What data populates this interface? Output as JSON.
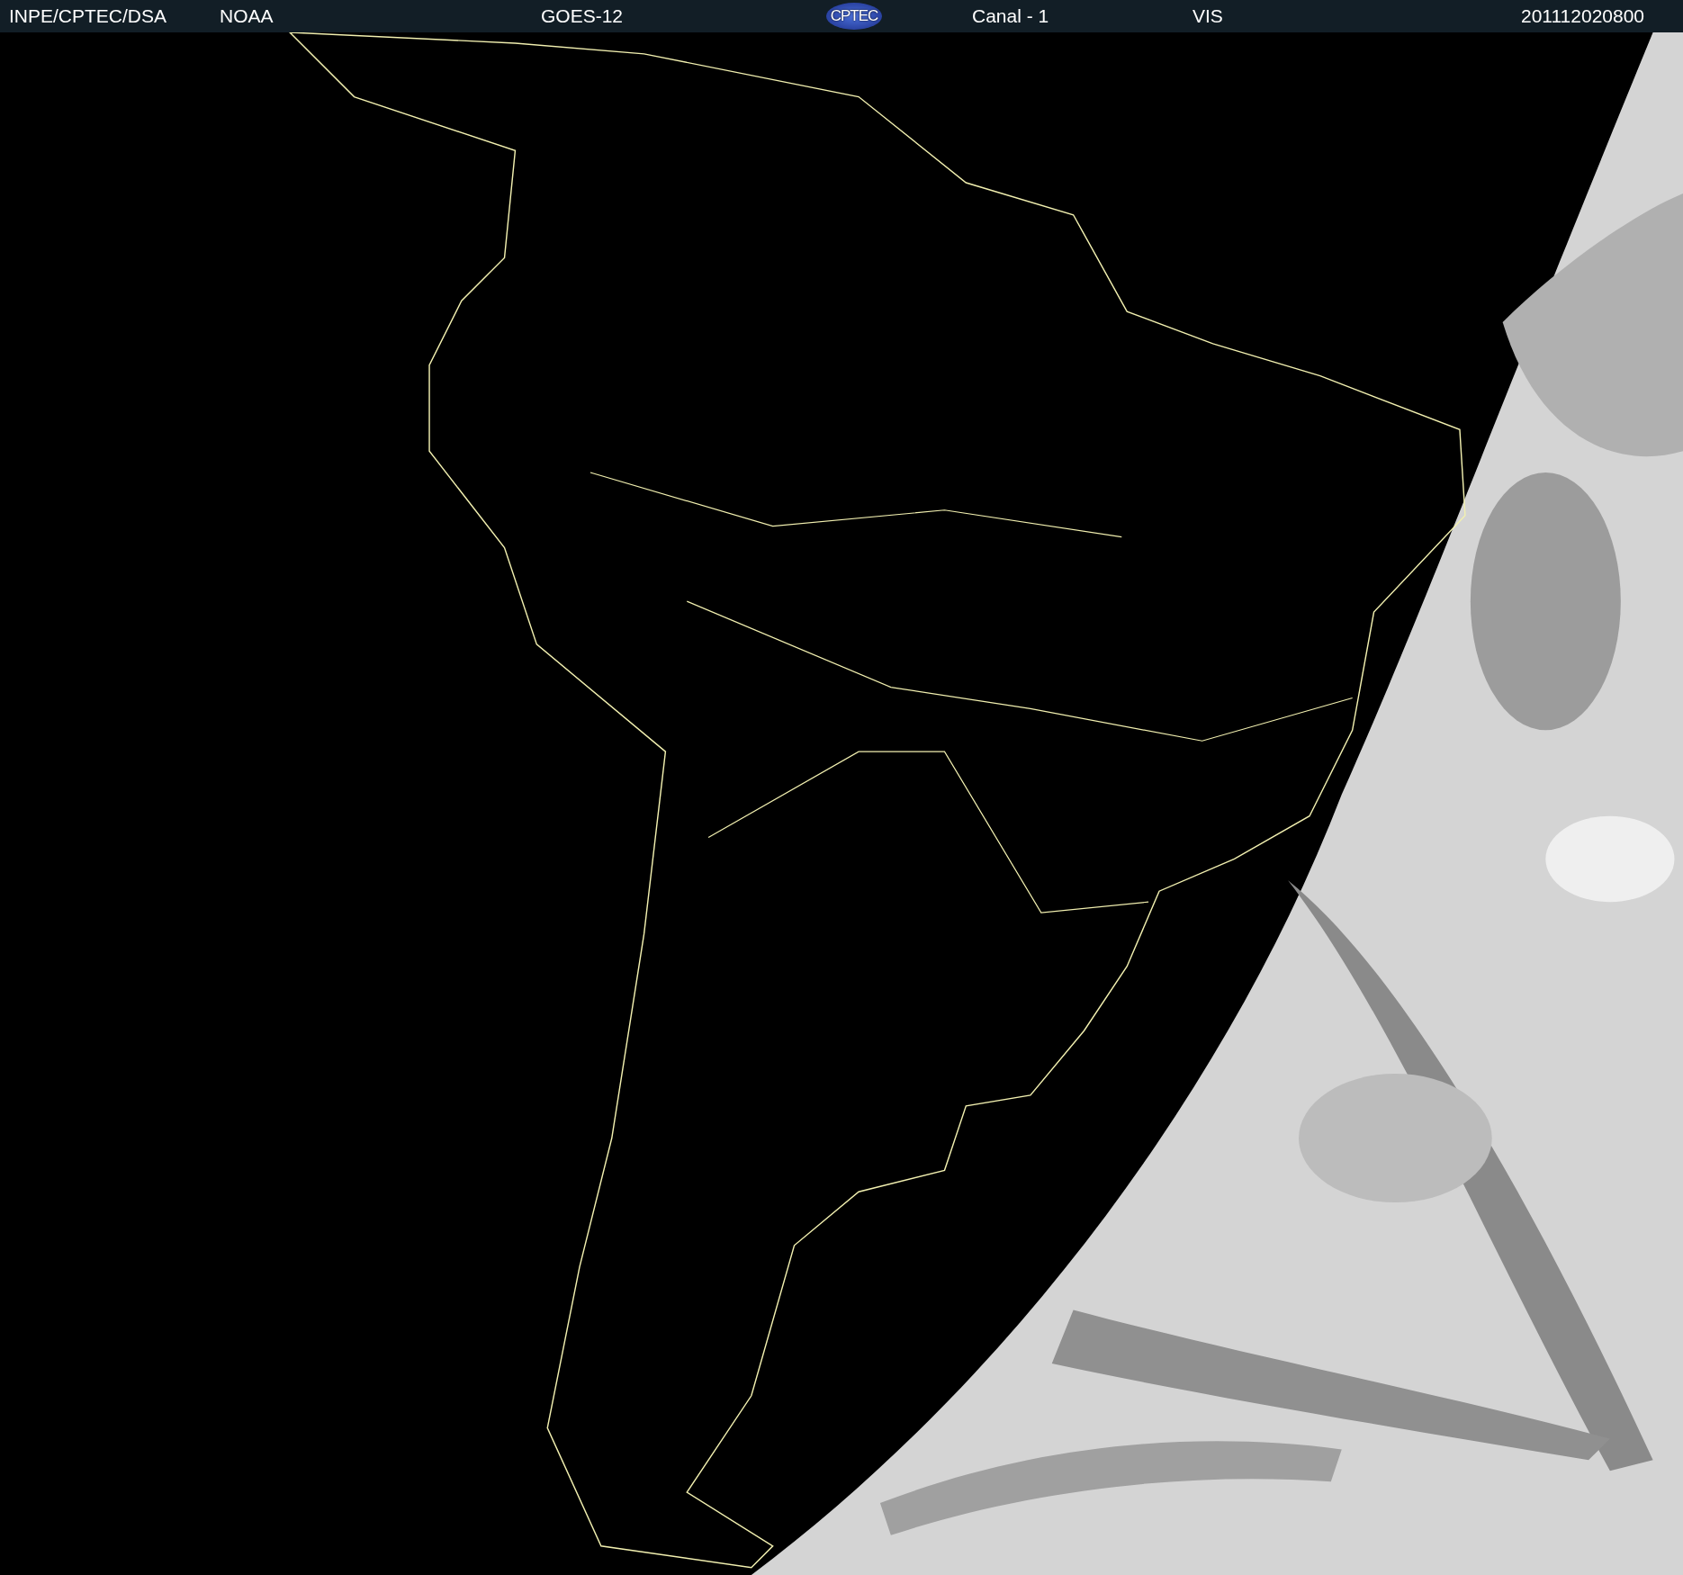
{
  "header": {
    "source": "INPE/CPTEC/DSA",
    "agency": "NOAA",
    "satellite": "GOES-12",
    "logo": "CPTEC",
    "channel": "Canal - 1",
    "band": "VIS",
    "timestamp": "201112020800"
  }
}
